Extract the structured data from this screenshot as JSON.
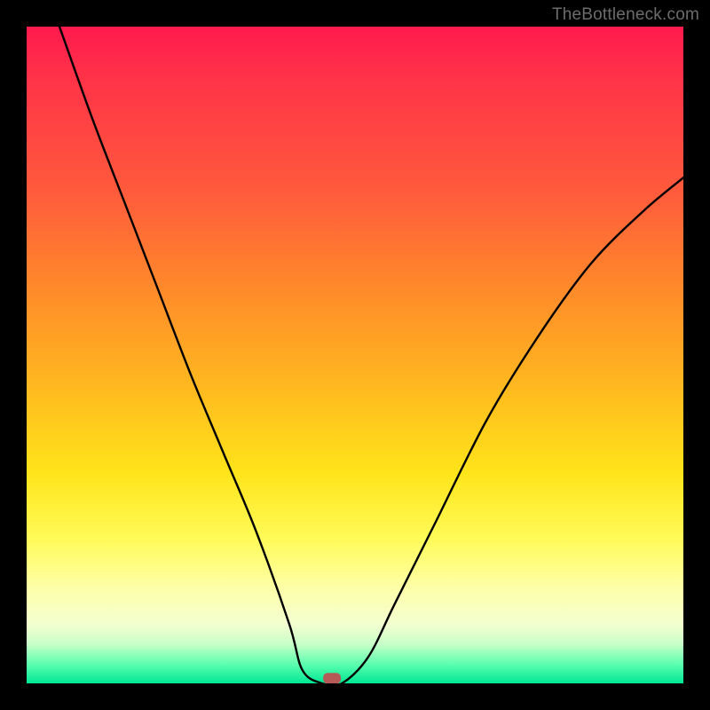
{
  "watermark": "TheBottleneck.com",
  "chart_data": {
    "type": "line",
    "title": "",
    "xlabel": "",
    "ylabel": "",
    "xlim": [
      0,
      1
    ],
    "ylim": [
      0,
      1
    ],
    "series": [
      {
        "name": "curve",
        "x": [
          0.05,
          0.1,
          0.15,
          0.2,
          0.25,
          0.3,
          0.35,
          0.4,
          0.42,
          0.45,
          0.48,
          0.52,
          0.56,
          0.62,
          0.7,
          0.78,
          0.86,
          0.94,
          1.0
        ],
        "y": [
          1.0,
          0.86,
          0.73,
          0.6,
          0.47,
          0.35,
          0.23,
          0.09,
          0.02,
          0.0,
          0.0,
          0.04,
          0.12,
          0.24,
          0.4,
          0.53,
          0.64,
          0.72,
          0.77
        ]
      }
    ],
    "marker": {
      "x": 0.465,
      "y": 0.005,
      "color": "#b65a57"
    },
    "gradient_stops": [
      {
        "pos": 0.0,
        "color": "#ff1a4d"
      },
      {
        "pos": 0.25,
        "color": "#ff5a3c"
      },
      {
        "pos": 0.55,
        "color": "#ffb91f"
      },
      {
        "pos": 0.78,
        "color": "#fffb58"
      },
      {
        "pos": 0.94,
        "color": "#c9ffc8"
      },
      {
        "pos": 1.0,
        "color": "#00e793"
      }
    ]
  }
}
